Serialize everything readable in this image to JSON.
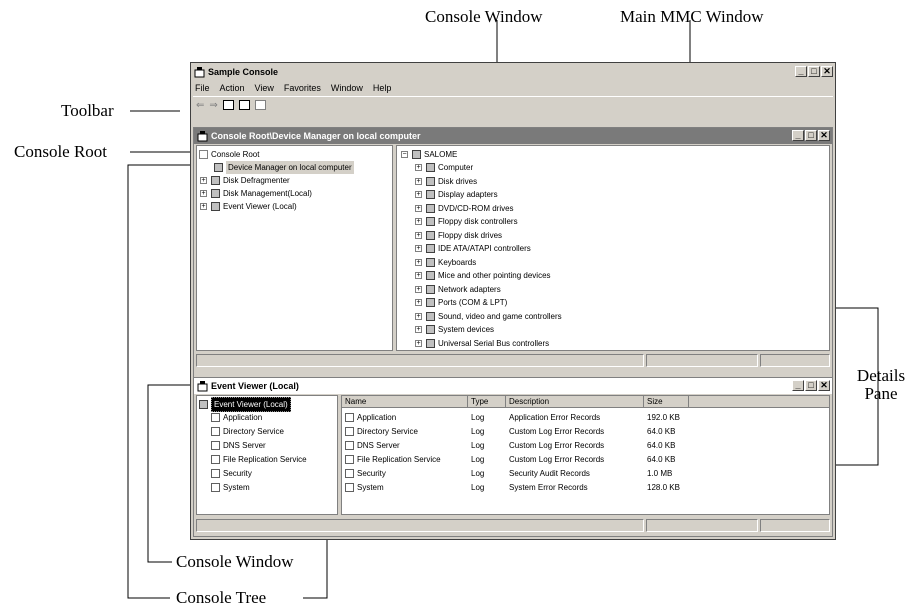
{
  "callouts": {
    "console_window_top": "Console Window",
    "main_window": "Main MMC Window",
    "toolbar": "Toolbar",
    "console_root": "Console Root",
    "details_pane": "Details\nPane",
    "console_window_bottom": "Console Window",
    "console_tree": "Console Tree"
  },
  "app": {
    "title": "Sample Console",
    "menu": [
      "File",
      "Action",
      "View",
      "Favorites",
      "Window",
      "Help"
    ]
  },
  "device_window": {
    "title": "Console Root\\Device Manager on local computer",
    "tree": {
      "root": "Console Root",
      "items": [
        "Device Manager on local computer",
        "Disk Defragmenter",
        "Disk Management(Local)",
        "Event Viewer (Local)"
      ]
    },
    "details": {
      "root": "SALOME",
      "items": [
        "Computer",
        "Disk drives",
        "Display adapters",
        "DVD/CD-ROM drives",
        "Floppy disk controllers",
        "Floppy disk drives",
        "IDE ATA/ATAPI controllers",
        "Keyboards",
        "Mice and other pointing devices",
        "Network adapters",
        "Ports (COM & LPT)",
        "Sound, video and game controllers",
        "System devices",
        "Universal Serial Bus controllers"
      ]
    }
  },
  "event_window": {
    "title": "Event Viewer (Local)",
    "tree": {
      "root": "Event Viewer (Local)",
      "items": [
        "Application",
        "Directory Service",
        "DNS Server",
        "File Replication Service",
        "Security",
        "System"
      ]
    },
    "columns": [
      "Name",
      "Type",
      "Description",
      "Size"
    ],
    "rows": [
      [
        "Application",
        "Log",
        "Application Error Records",
        "192.0 KB"
      ],
      [
        "Directory Service",
        "Log",
        "Custom Log Error Records",
        "64.0 KB"
      ],
      [
        "DNS Server",
        "Log",
        "Custom Log Error Records",
        "64.0 KB"
      ],
      [
        "File Replication Service",
        "Log",
        "Custom Log Error Records",
        "64.0 KB"
      ],
      [
        "Security",
        "Log",
        "Security Audit Records",
        "1.0 MB"
      ],
      [
        "System",
        "Log",
        "System Error Records",
        "128.0 KB"
      ]
    ]
  },
  "icons": {
    "app": "mmc-app-icon",
    "back": "back-arrow-icon",
    "forward": "forward-arrow-icon",
    "show_hide": "show-hide-tree-icon",
    "export": "export-list-icon",
    "help": "help-icon",
    "minimize": "minimize-icon",
    "maximize": "maximize-icon",
    "close": "close-icon"
  },
  "glyphs": {
    "back": "⇐",
    "forward": "⇒",
    "minimize": "_",
    "maximize": "□",
    "close": "✕",
    "collapse": "−",
    "expand": "+"
  }
}
